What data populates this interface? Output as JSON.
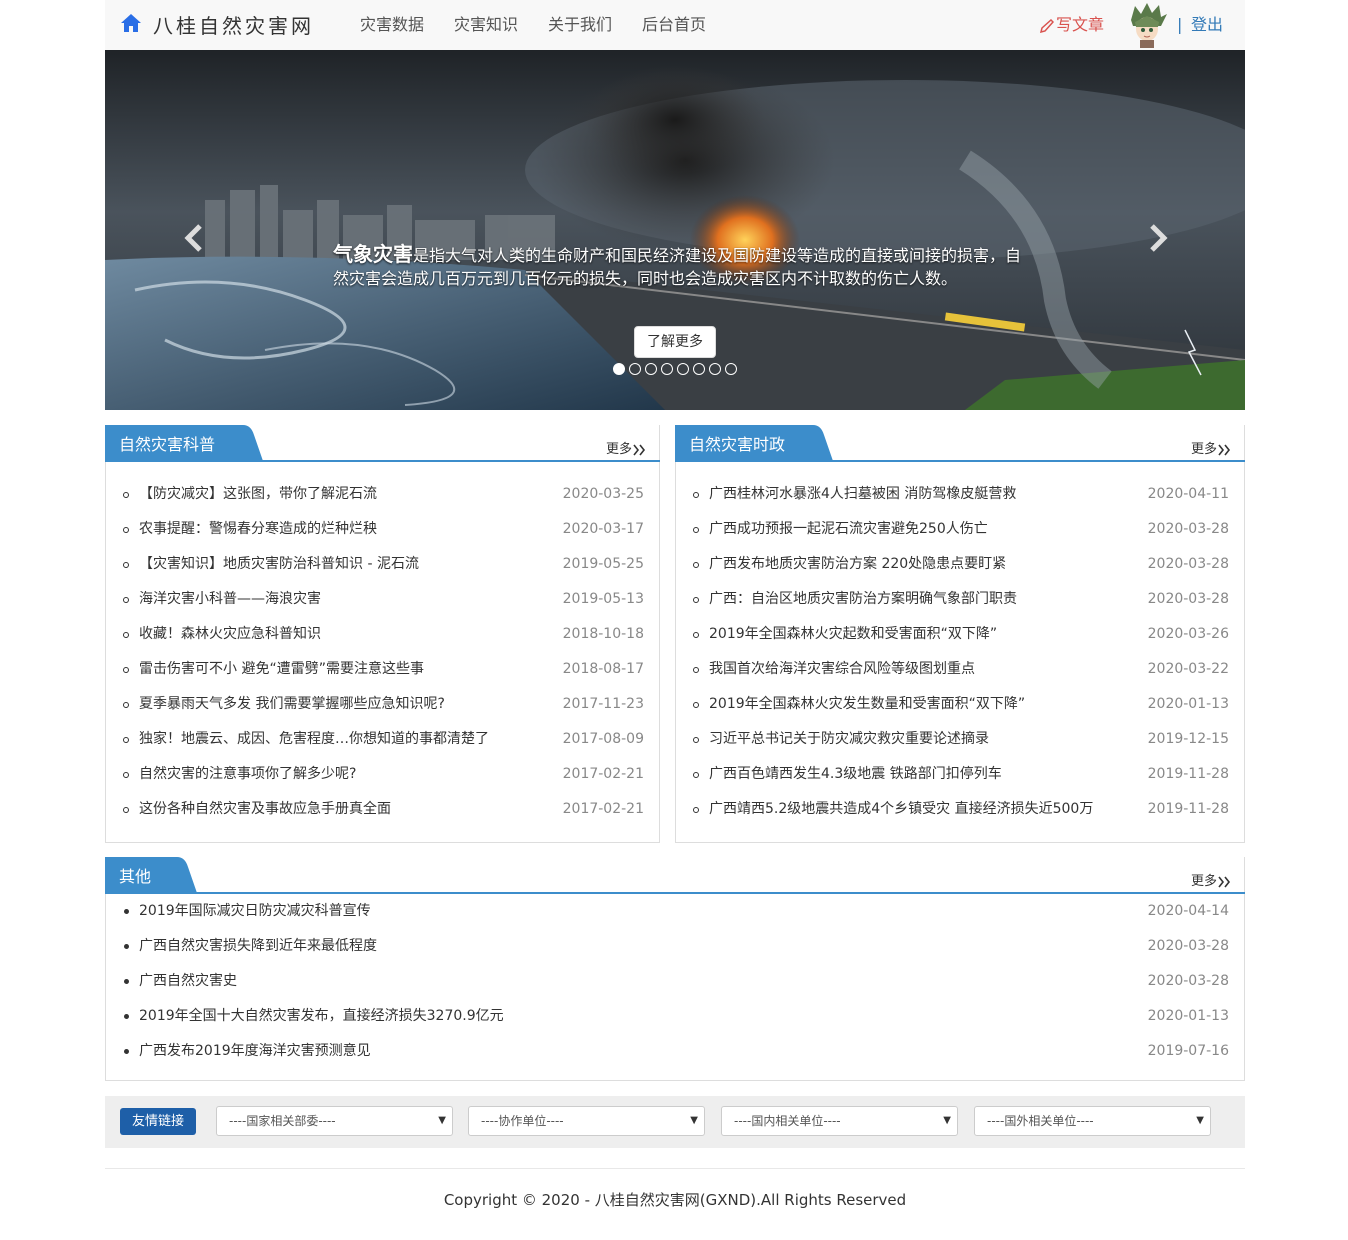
{
  "header": {
    "brand": "八桂自然灾害网",
    "nav": [
      "灾害数据",
      "灾害知识",
      "关于我们",
      "后台首页"
    ],
    "write_label": "写文章",
    "separator": "|",
    "logout_label": "登出",
    "accent_color": "#337ab7"
  },
  "carousel": {
    "caption_title": "气象灾害",
    "caption_body": "是指大气对人类的生命财产和国民经济建设及国防建设等造成的直接或间接的损害，自然灾害会造成几百万元到几百亿元的损失，同时也会造成灾害区内不计取数的伤亡人数。",
    "button_label": "了解更多",
    "slide_count": 8,
    "active_slide": 1
  },
  "science": {
    "title": "自然灾害科普",
    "more": "更多",
    "items": [
      {
        "title": "【防灾减灾】这张图，带你了解泥石流",
        "date": "2020-03-25"
      },
      {
        "title": "农事提醒：警惕春分寒造成的烂种烂秧",
        "date": "2020-03-17"
      },
      {
        "title": "【灾害知识】地质灾害防治科普知识 - 泥石流",
        "date": "2019-05-25"
      },
      {
        "title": "海洋灾害小科普——海浪灾害",
        "date": "2019-05-13"
      },
      {
        "title": "收藏！森林火灾应急科普知识",
        "date": "2018-10-18"
      },
      {
        "title": "雷击伤害可不小 避免“遭雷劈”需要注意这些事",
        "date": "2018-08-17"
      },
      {
        "title": "夏季暴雨天气多发 我们需要掌握哪些应急知识呢?",
        "date": "2017-11-23"
      },
      {
        "title": "独家！地震云、成因、危害程度…你想知道的事都清楚了",
        "date": "2017-08-09"
      },
      {
        "title": "自然灾害的注意事项你了解多少呢?",
        "date": "2017-02-21"
      },
      {
        "title": "这份各种自然灾害及事故应急手册真全面",
        "date": "2017-02-21"
      }
    ]
  },
  "politics": {
    "title": "自然灾害时政",
    "more": "更多",
    "items": [
      {
        "title": "广西桂林河水暴涨4人扫墓被困 消防驾橡皮艇营救",
        "date": "2020-04-11"
      },
      {
        "title": "广西成功预报一起泥石流灾害避免250人伤亡",
        "date": "2020-03-28"
      },
      {
        "title": "广西发布地质灾害防治方案 220处隐患点要盯紧",
        "date": "2020-03-28"
      },
      {
        "title": "广西：自治区地质灾害防治方案明确气象部门职责",
        "date": "2020-03-28"
      },
      {
        "title": "2019年全国森林火灾起数和受害面积“双下降”",
        "date": "2020-03-26"
      },
      {
        "title": "我国首次给海洋灾害综合风险等级图划重点",
        "date": "2020-03-22"
      },
      {
        "title": "2019年全国森林火灾发生数量和受害面积“双下降”",
        "date": "2020-01-13"
      },
      {
        "title": "习近平总书记关于防灾减灾救灾重要论述摘录",
        "date": "2019-12-15"
      },
      {
        "title": "广西百色靖西发生4.3级地震 铁路部门扣停列车",
        "date": "2019-11-28"
      },
      {
        "title": "广西靖西5.2级地震共造成4个乡镇受灾 直接经济损失近500万",
        "date": "2019-11-28"
      }
    ]
  },
  "other": {
    "title": "其他",
    "more": "更多",
    "items": [
      {
        "title": "2019年国际减灾日防灾减灾科普宣传",
        "date": "2020-04-14"
      },
      {
        "title": "广西自然灾害损失降到近年来最低程度",
        "date": "2020-03-28"
      },
      {
        "title": "广西自然灾害史",
        "date": "2020-03-28"
      },
      {
        "title": "2019年全国十大自然灾害发布，直接经济损失3270.9亿元",
        "date": "2020-01-13"
      },
      {
        "title": "广西发布2019年度海洋灾害预测意见",
        "date": "2019-07-16"
      }
    ]
  },
  "friends": {
    "label": "友情链接",
    "selects": [
      "----国家相关部委----",
      "----协作单位----",
      "----国内相关单位----",
      "----国外相关单位----"
    ]
  },
  "footer": {
    "copyright": "Copyright © 2020 - 八桂自然灾害网(GXND).All Rights Reserved"
  }
}
